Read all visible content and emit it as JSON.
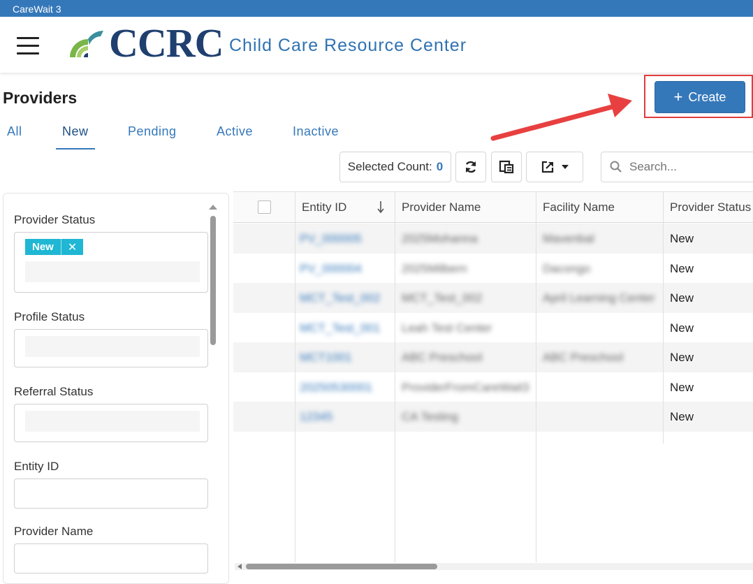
{
  "app": {
    "title": "CareWait 3"
  },
  "header": {
    "brand": "CCRC",
    "subtitle": "Child Care Resource Center",
    "colors": {
      "bar": "#3578ba",
      "brand": "#1f3f6f",
      "accent": "#2f72b2"
    }
  },
  "page": {
    "title": "Providers"
  },
  "tabs": [
    {
      "label": "All",
      "active": false
    },
    {
      "label": "New",
      "active": true
    },
    {
      "label": "Pending",
      "active": false
    },
    {
      "label": "Active",
      "active": false
    },
    {
      "label": "Inactive",
      "active": false
    }
  ],
  "actions": {
    "create_label": "Create",
    "create_icon": "plus-icon"
  },
  "toolbar": {
    "selected_count_label": "Selected Count:",
    "selected_count_value": "0",
    "refresh_icon": "refresh-icon",
    "columns_icon": "columns-icon",
    "export_icon": "export-icon",
    "search_placeholder": "Search..."
  },
  "filters": {
    "provider_status_label": "Provider Status",
    "provider_status_chip": "New",
    "profile_status_label": "Profile Status",
    "referral_status_label": "Referral Status",
    "entity_id_label": "Entity ID",
    "provider_name_label": "Provider Name"
  },
  "grid": {
    "columns": [
      "Entity ID",
      "Provider Name",
      "Facility Name",
      "Provider Status"
    ],
    "sort_icon": "sort-down-arrow-icon",
    "rows": [
      {
        "entity_id": "PV_000005",
        "provider_name": "2025Mohanna",
        "facility_name": "Mavenbal",
        "status": "New"
      },
      {
        "entity_id": "PV_000004",
        "provider_name": "2025Milbern",
        "facility_name": "Dacongo",
        "status": "New"
      },
      {
        "entity_id": "MCT_Test_002",
        "provider_name": "MCT_Test_002",
        "facility_name": "April Learning Center",
        "status": "New"
      },
      {
        "entity_id": "MCT_Test_001",
        "provider_name": "Leah Test Center",
        "facility_name": "",
        "status": "New"
      },
      {
        "entity_id": "MCT1001",
        "provider_name": "ABC Preschool",
        "facility_name": "ABC Preschool",
        "status": "New"
      },
      {
        "entity_id": "20250530001",
        "provider_name": "ProviderFromCareWait3",
        "facility_name": "",
        "status": "New"
      },
      {
        "entity_id": "12345",
        "provider_name": "CA Testing",
        "facility_name": "",
        "status": "New"
      }
    ]
  }
}
